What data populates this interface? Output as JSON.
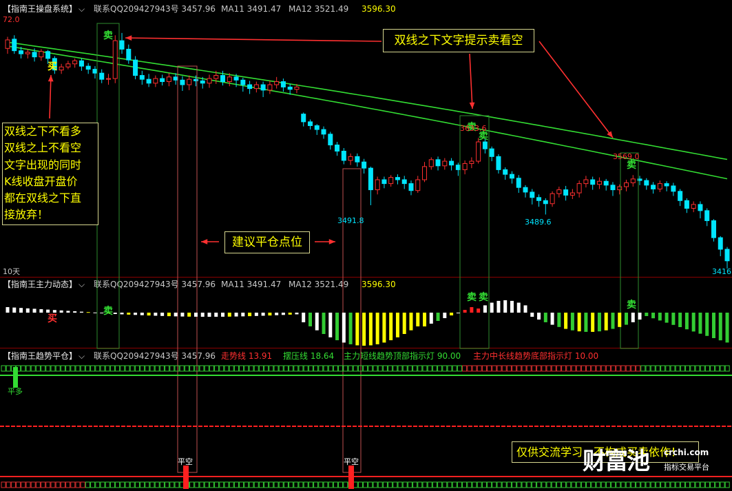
{
  "panel1": {
    "title": "【指南王操盘系统】",
    "contact": "联系QQ209427943号 3457.96",
    "ma11": "MA11 3491.47",
    "ma12": "MA12 3521.49",
    "value": "3596.30",
    "top_price": "72.0",
    "period": "10天"
  },
  "panel2": {
    "title": "【指南王主力动态】",
    "contact": "联系QQ209427943号 3457.96",
    "ma11": "MA11 3491.47",
    "ma12": "MA12 3521.49",
    "value": "3596.30"
  },
  "panel3": {
    "title": "【指南王趋势平仓】",
    "contact": "联系QQ209427943号 3457.96",
    "trend": "走势线 13.91",
    "pressure": "摆压线 18.64",
    "short_top": "主力短线趋势顶部指示灯 90.00",
    "long_bottom": "主力中长线趋势底部指示灯 10.00"
  },
  "annotations": {
    "top_right": "双线之下文字提示卖看空",
    "left_box": [
      "双线之下不看多",
      "双线之上不看空",
      "文字出现的同时",
      "K线收盘开盘价",
      "都在双线之下直",
      "接放弃！"
    ],
    "middle": "建议平仓点位",
    "bottom": "仅供交流学习，不构成买卖依作！"
  },
  "price_labels": {
    "p1": "3491.8",
    "p2": "3489.6",
    "p3": "3569.0",
    "p4": "3633.6",
    "p5": "3416"
  },
  "signals": {
    "sell": "卖",
    "buy": "买",
    "close_short": "平空",
    "close_long": "平多"
  },
  "watermark": {
    "brand": "财富池",
    "site": "crchi.com",
    "sub": "指标交易平台"
  },
  "colors": {
    "up": "#ff3030",
    "down": "#00e5ff",
    "ma": "#33dd33",
    "note_text": "#ffff00",
    "header_value": "#ffff00"
  },
  "candles": [
    [
      3595,
      3606,
      3588,
      3610
    ],
    [
      3607,
      3592,
      3588,
      3612
    ],
    [
      3592,
      3588,
      3582,
      3597
    ],
    [
      3588,
      3590,
      3582,
      3594
    ],
    [
      3590,
      3584,
      3578,
      3595
    ],
    [
      3584,
      3591,
      3579,
      3594
    ],
    [
      3591,
      3582,
      3575,
      3593
    ],
    [
      3582,
      3567,
      3562,
      3585
    ],
    [
      3567,
      3571,
      3562,
      3575
    ],
    [
      3571,
      3575,
      3568,
      3579
    ],
    [
      3575,
      3579,
      3570,
      3582
    ],
    [
      3579,
      3572,
      3566,
      3582
    ],
    [
      3572,
      3568,
      3562,
      3576
    ],
    [
      3568,
      3563,
      3556,
      3572
    ],
    [
      3563,
      3555,
      3550,
      3568
    ],
    [
      3555,
      3556,
      3548,
      3562
    ],
    [
      3556,
      3605,
      3550,
      3612
    ],
    [
      3605,
      3594,
      3588,
      3615
    ],
    [
      3594,
      3580,
      3575,
      3600
    ],
    [
      3580,
      3560,
      3555,
      3585
    ],
    [
      3560,
      3555,
      3548,
      3566
    ],
    [
      3555,
      3550,
      3545,
      3562
    ],
    [
      3550,
      3556,
      3545,
      3560
    ],
    [
      3556,
      3552,
      3547,
      3561
    ],
    [
      3552,
      3558,
      3546,
      3563
    ],
    [
      3558,
      3554,
      3548,
      3563
    ],
    [
      3554,
      3548,
      3540,
      3559
    ],
    [
      3548,
      3555,
      3541,
      3560
    ],
    [
      3555,
      3553,
      3546,
      3560
    ],
    [
      3553,
      3550,
      3543,
      3558
    ],
    [
      3550,
      3556,
      3544,
      3561
    ],
    [
      3556,
      3560,
      3549,
      3566
    ],
    [
      3560,
      3552,
      3547,
      3566
    ],
    [
      3552,
      3558,
      3546,
      3563
    ],
    [
      3558,
      3554,
      3545,
      3562
    ],
    [
      3554,
      3548,
      3539,
      3557
    ],
    [
      3548,
      3543,
      3536,
      3553
    ],
    [
      3543,
      3548,
      3538,
      3552
    ],
    [
      3548,
      3541,
      3532,
      3552
    ],
    [
      3541,
      3548,
      3536,
      3553
    ],
    [
      3548,
      3552,
      3543,
      3558
    ],
    [
      3552,
      3545,
      3539,
      3556
    ],
    [
      3545,
      3542,
      3535,
      3549
    ],
    [
      3542,
      3545,
      3537,
      3549
    ],
    [
      3510,
      3500,
      3494,
      3512
    ],
    [
      3500,
      3495,
      3490,
      3503
    ],
    [
      3495,
      3490,
      3483,
      3497
    ],
    [
      3490,
      3484,
      3478,
      3494
    ],
    [
      3484,
      3470,
      3464,
      3487
    ],
    [
      3470,
      3462,
      3456,
      3474
    ],
    [
      3462,
      3450,
      3445,
      3466
    ],
    [
      3450,
      3455,
      3444,
      3459
    ],
    [
      3455,
      3448,
      3442,
      3459
    ],
    [
      3448,
      3440,
      3433,
      3452
    ],
    [
      3440,
      3412,
      3392,
      3442
    ],
    [
      3412,
      3425,
      3406,
      3429
    ],
    [
      3425,
      3420,
      3414,
      3429
    ],
    [
      3420,
      3428,
      3416,
      3431
    ],
    [
      3428,
      3425,
      3419,
      3432
    ],
    [
      3425,
      3420,
      3413,
      3430
    ],
    [
      3420,
      3411,
      3405,
      3424
    ],
    [
      3411,
      3425,
      3408,
      3430
    ],
    [
      3425,
      3442,
      3422,
      3448
    ],
    [
      3442,
      3451,
      3438,
      3454
    ],
    [
      3451,
      3443,
      3437,
      3455
    ],
    [
      3443,
      3449,
      3438,
      3453
    ],
    [
      3449,
      3444,
      3437,
      3453
    ],
    [
      3444,
      3438,
      3430,
      3447
    ],
    [
      3438,
      3446,
      3432,
      3450
    ],
    [
      3446,
      3449,
      3440,
      3454
    ],
    [
      3449,
      3474,
      3446,
      3479
    ],
    [
      3474,
      3465,
      3459,
      3478
    ],
    [
      3465,
      3455,
      3449,
      3468
    ],
    [
      3455,
      3438,
      3433,
      3458
    ],
    [
      3438,
      3432,
      3425,
      3441
    ],
    [
      3432,
      3427,
      3420,
      3436
    ],
    [
      3427,
      3415,
      3408,
      3431
    ],
    [
      3415,
      3409,
      3402,
      3418
    ],
    [
      3409,
      3402,
      3393,
      3413
    ],
    [
      3402,
      3398,
      3390,
      3406
    ],
    [
      3398,
      3394,
      3380,
      3401
    ],
    [
      3394,
      3407,
      3390,
      3410
    ],
    [
      3407,
      3412,
      3402,
      3416
    ],
    [
      3412,
      3405,
      3398,
      3417
    ],
    [
      3405,
      3408,
      3400,
      3413
    ],
    [
      3408,
      3420,
      3402,
      3424
    ],
    [
      3420,
      3425,
      3415,
      3430
    ],
    [
      3425,
      3419,
      3412,
      3429
    ],
    [
      3419,
      3423,
      3413,
      3428
    ],
    [
      3423,
      3418,
      3411,
      3426
    ],
    [
      3418,
      3412,
      3404,
      3422
    ],
    [
      3412,
      3416,
      3406,
      3419
    ],
    [
      3416,
      3421,
      3410,
      3425
    ],
    [
      3421,
      3426,
      3416,
      3431
    ],
    [
      3426,
      3424,
      3418,
      3430
    ],
    [
      3424,
      3418,
      3412,
      3427
    ],
    [
      3418,
      3413,
      3407,
      3422
    ],
    [
      3413,
      3420,
      3409,
      3424
    ],
    [
      3420,
      3417,
      3410,
      3423
    ],
    [
      3417,
      3410,
      3404,
      3421
    ],
    [
      3410,
      3398,
      3391,
      3413
    ],
    [
      3398,
      3388,
      3382,
      3401
    ],
    [
      3388,
      3393,
      3383,
      3397
    ],
    [
      3393,
      3385,
      3375,
      3397
    ],
    [
      3385,
      3372,
      3365,
      3388
    ],
    [
      3372,
      3350,
      3345,
      3374
    ],
    [
      3350,
      3335,
      3326,
      3352
    ],
    [
      3335,
      3320,
      3310,
      3338
    ]
  ]
}
